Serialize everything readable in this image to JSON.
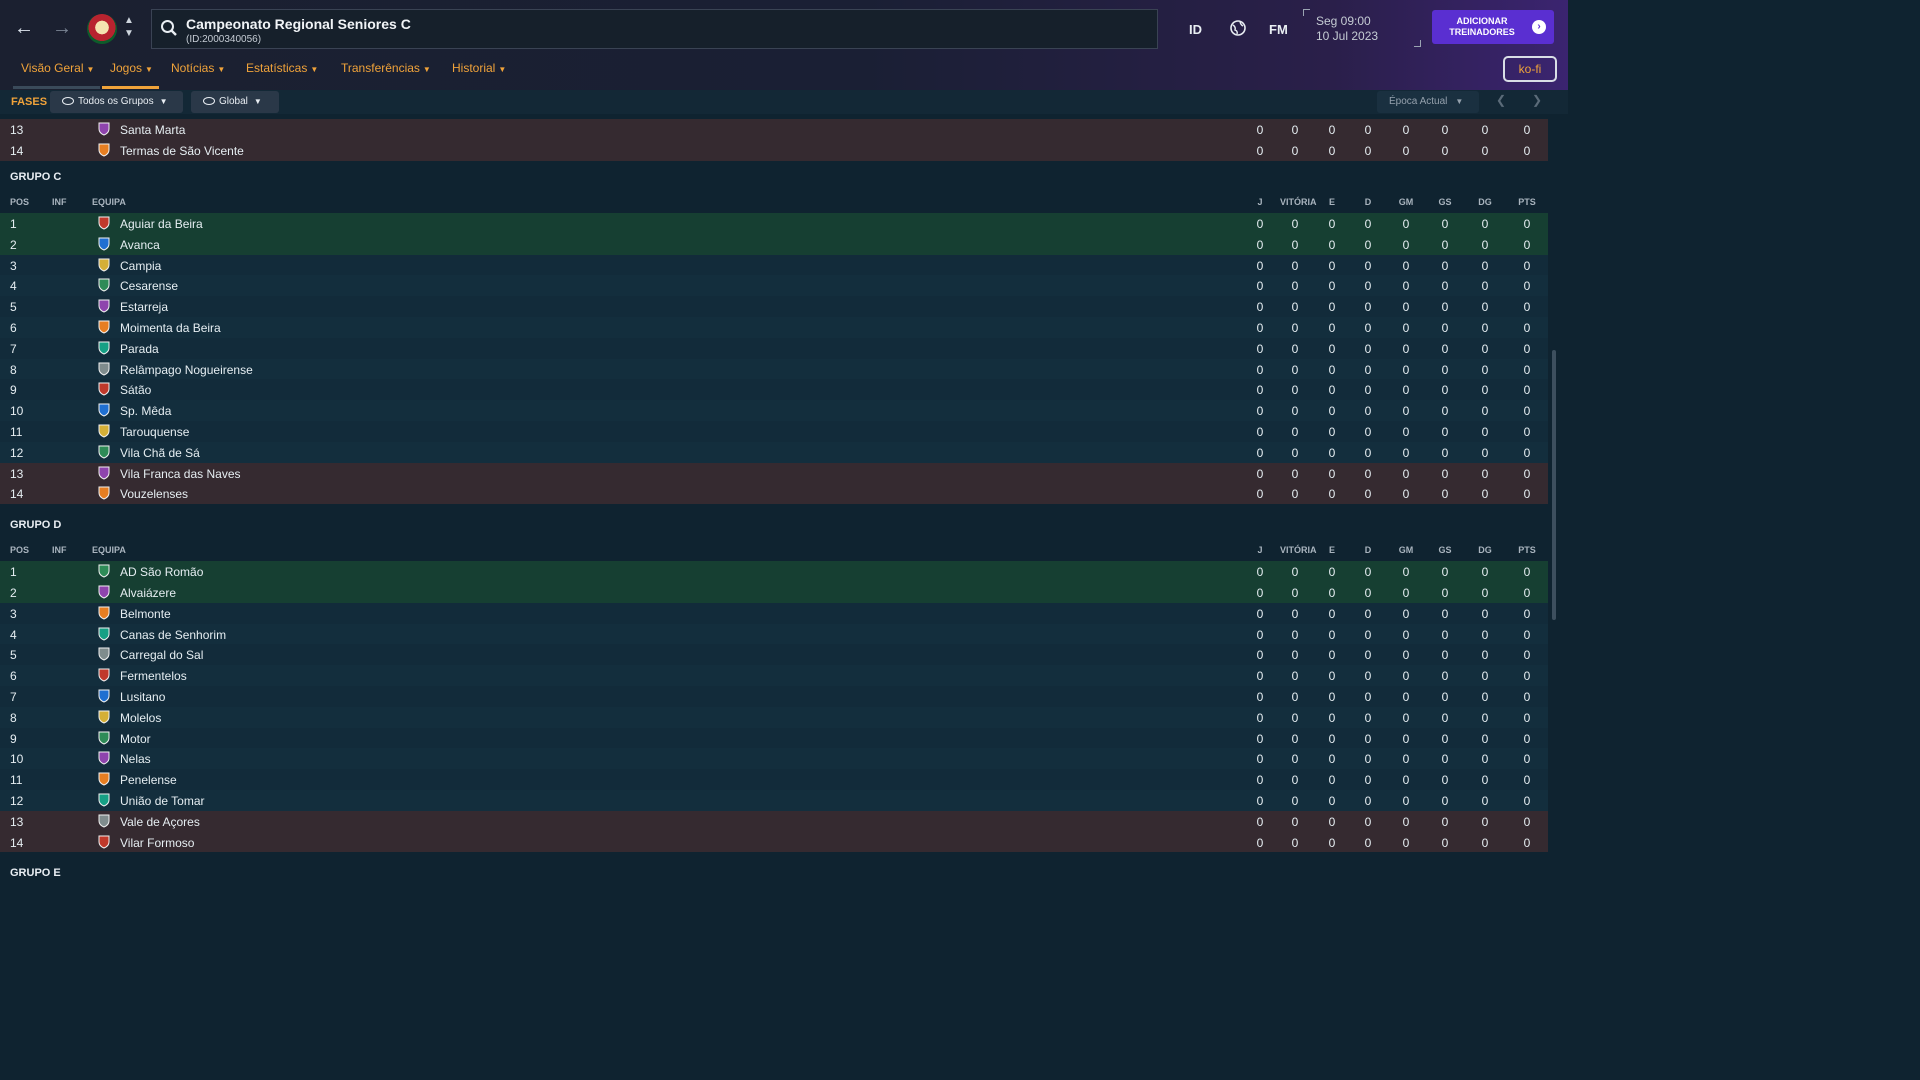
{
  "header": {
    "title": "Campeonato Regional Seniores C",
    "id_label": "(ID:2000340056)",
    "search_placeholder": "",
    "shortcut_id": "ID",
    "shortcut_fm": "FM",
    "date_line1": "Seg 09:00",
    "date_line2": "10 Jul 2023",
    "add_coaches": "ADICIONAR TREINADORES",
    "kofi": "ko-fi"
  },
  "tabs": [
    {
      "label": "Visão Geral",
      "active": false
    },
    {
      "label": "Jogos",
      "active": true
    },
    {
      "label": "Notícias",
      "active": false
    },
    {
      "label": "Estatísticas",
      "active": false
    },
    {
      "label": "Transferências",
      "active": false
    },
    {
      "label": "Historial",
      "active": false
    }
  ],
  "filters": {
    "stages_label": "FASES",
    "groups": "Todos os Grupos",
    "scope": "Global",
    "season": "Época Actual"
  },
  "columns": [
    "POS",
    "INF",
    "EQUIPA",
    "J",
    "VITÓRIA",
    "E",
    "D",
    "GM",
    "GS",
    "DG",
    "PTS"
  ],
  "partial_top": [
    {
      "pos": "13",
      "team": "Santa Marta",
      "stats": [
        "0",
        "0",
        "0",
        "0",
        "0",
        "0",
        "0",
        "0"
      ]
    },
    {
      "pos": "14",
      "team": "Termas de São Vicente",
      "stats": [
        "0",
        "0",
        "0",
        "0",
        "0",
        "0",
        "0",
        "0"
      ]
    }
  ],
  "groups": [
    {
      "title": "GRUPO C",
      "rows": [
        {
          "pos": "1",
          "team": "Aguiar da Beira",
          "stats": [
            "0",
            "0",
            "0",
            "0",
            "0",
            "0",
            "0",
            "0"
          ]
        },
        {
          "pos": "2",
          "team": "Avanca",
          "stats": [
            "0",
            "0",
            "0",
            "0",
            "0",
            "0",
            "0",
            "0"
          ]
        },
        {
          "pos": "3",
          "team": "Campia",
          "stats": [
            "0",
            "0",
            "0",
            "0",
            "0",
            "0",
            "0",
            "0"
          ]
        },
        {
          "pos": "4",
          "team": "Cesarense",
          "stats": [
            "0",
            "0",
            "0",
            "0",
            "0",
            "0",
            "0",
            "0"
          ]
        },
        {
          "pos": "5",
          "team": "Estarreja",
          "stats": [
            "0",
            "0",
            "0",
            "0",
            "0",
            "0",
            "0",
            "0"
          ]
        },
        {
          "pos": "6",
          "team": "Moimenta da Beira",
          "stats": [
            "0",
            "0",
            "0",
            "0",
            "0",
            "0",
            "0",
            "0"
          ]
        },
        {
          "pos": "7",
          "team": "Parada",
          "stats": [
            "0",
            "0",
            "0",
            "0",
            "0",
            "0",
            "0",
            "0"
          ]
        },
        {
          "pos": "8",
          "team": "Relâmpago Nogueirense",
          "stats": [
            "0",
            "0",
            "0",
            "0",
            "0",
            "0",
            "0",
            "0"
          ]
        },
        {
          "pos": "9",
          "team": "Sátão",
          "stats": [
            "0",
            "0",
            "0",
            "0",
            "0",
            "0",
            "0",
            "0"
          ]
        },
        {
          "pos": "10",
          "team": "Sp. Mêda",
          "stats": [
            "0",
            "0",
            "0",
            "0",
            "0",
            "0",
            "0",
            "0"
          ]
        },
        {
          "pos": "11",
          "team": "Tarouquense",
          "stats": [
            "0",
            "0",
            "0",
            "0",
            "0",
            "0",
            "0",
            "0"
          ]
        },
        {
          "pos": "12",
          "team": "Vila Chã de Sá",
          "stats": [
            "0",
            "0",
            "0",
            "0",
            "0",
            "0",
            "0",
            "0"
          ]
        },
        {
          "pos": "13",
          "team": "Vila Franca das Naves",
          "stats": [
            "0",
            "0",
            "0",
            "0",
            "0",
            "0",
            "0",
            "0"
          ]
        },
        {
          "pos": "14",
          "team": "Vouzelenses",
          "stats": [
            "0",
            "0",
            "0",
            "0",
            "0",
            "0",
            "0",
            "0"
          ]
        }
      ]
    },
    {
      "title": "GRUPO D",
      "rows": [
        {
          "pos": "1",
          "team": "AD São Romão",
          "stats": [
            "0",
            "0",
            "0",
            "0",
            "0",
            "0",
            "0",
            "0"
          ]
        },
        {
          "pos": "2",
          "team": "Alvaiázere",
          "stats": [
            "0",
            "0",
            "0",
            "0",
            "0",
            "0",
            "0",
            "0"
          ]
        },
        {
          "pos": "3",
          "team": "Belmonte",
          "stats": [
            "0",
            "0",
            "0",
            "0",
            "0",
            "0",
            "0",
            "0"
          ]
        },
        {
          "pos": "4",
          "team": "Canas de Senhorim",
          "stats": [
            "0",
            "0",
            "0",
            "0",
            "0",
            "0",
            "0",
            "0"
          ]
        },
        {
          "pos": "5",
          "team": "Carregal do Sal",
          "stats": [
            "0",
            "0",
            "0",
            "0",
            "0",
            "0",
            "0",
            "0"
          ]
        },
        {
          "pos": "6",
          "team": "Fermentelos",
          "stats": [
            "0",
            "0",
            "0",
            "0",
            "0",
            "0",
            "0",
            "0"
          ]
        },
        {
          "pos": "7",
          "team": "Lusitano",
          "stats": [
            "0",
            "0",
            "0",
            "0",
            "0",
            "0",
            "0",
            "0"
          ]
        },
        {
          "pos": "8",
          "team": "Molelos",
          "stats": [
            "0",
            "0",
            "0",
            "0",
            "0",
            "0",
            "0",
            "0"
          ]
        },
        {
          "pos": "9",
          "team": "Motor",
          "stats": [
            "0",
            "0",
            "0",
            "0",
            "0",
            "0",
            "0",
            "0"
          ]
        },
        {
          "pos": "10",
          "team": "Nelas",
          "stats": [
            "0",
            "0",
            "0",
            "0",
            "0",
            "0",
            "0",
            "0"
          ]
        },
        {
          "pos": "11",
          "team": "Penelense",
          "stats": [
            "0",
            "0",
            "0",
            "0",
            "0",
            "0",
            "0",
            "0"
          ]
        },
        {
          "pos": "12",
          "team": "União de Tomar",
          "stats": [
            "0",
            "0",
            "0",
            "0",
            "0",
            "0",
            "0",
            "0"
          ]
        },
        {
          "pos": "13",
          "team": "Vale de Açores",
          "stats": [
            "0",
            "0",
            "0",
            "0",
            "0",
            "0",
            "0",
            "0"
          ]
        },
        {
          "pos": "14",
          "team": "Vilar Formoso",
          "stats": [
            "0",
            "0",
            "0",
            "0",
            "0",
            "0",
            "0",
            "0"
          ]
        }
      ]
    },
    {
      "title": "GRUPO E",
      "rows": []
    }
  ],
  "colors": {
    "accent": "#f0a33a",
    "promotion_row": "#163f32",
    "relegation_row": "#352a30",
    "primary_button": "#5a2fd1"
  }
}
